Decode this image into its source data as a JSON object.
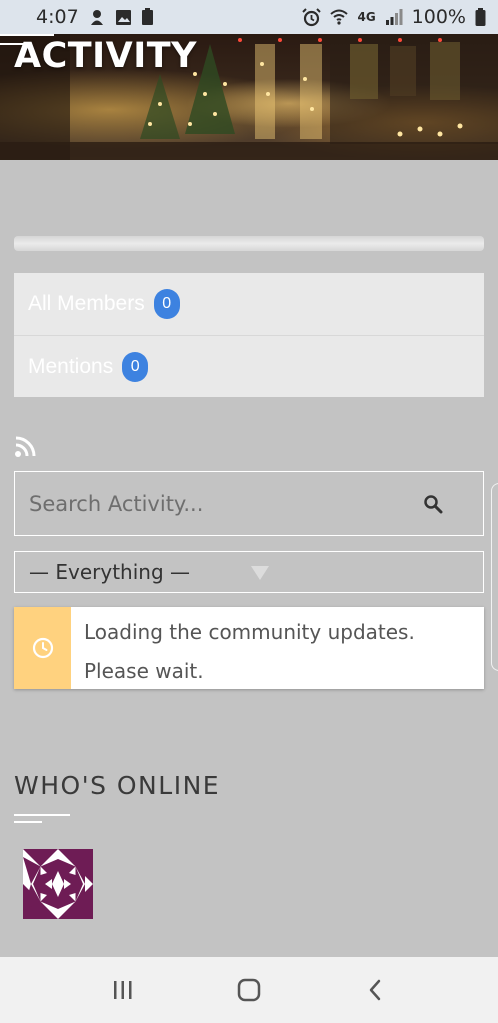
{
  "status_bar": {
    "time": "4:07",
    "network": "4G",
    "battery": "100%"
  },
  "hero": {
    "title": "ACTIVITY"
  },
  "tabs": [
    {
      "label": "All Members",
      "count": "0"
    },
    {
      "label": "Mentions",
      "count": "0"
    }
  ],
  "search": {
    "placeholder": "Search Activity..."
  },
  "filter": {
    "selected": "— Everything —"
  },
  "notice": {
    "line1": "Loading the community updates.",
    "line2": "Please wait."
  },
  "whos_online": {
    "title": "WHO'S ONLINE"
  },
  "colors": {
    "badge": "#3d82e0",
    "notice_accent": "#ffd27f",
    "page_background": "#c3c3c3",
    "avatar_primary": "#6e1c55"
  }
}
